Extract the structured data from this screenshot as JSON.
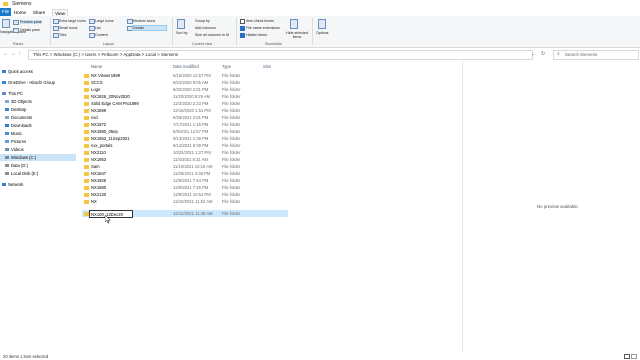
{
  "window": {
    "title": "Siemens"
  },
  "ribbon_tabs": [
    "File",
    "Home",
    "Share",
    "View"
  ],
  "ribbon": {
    "panes": {
      "navigation_pane": "Navigation pane",
      "preview_pane": "Preview pane",
      "details_pane": "Details pane",
      "group_label": "Panes"
    },
    "layout": {
      "items": [
        "Extra large icons",
        "Large icons",
        "Medium icons",
        "Small icons",
        "List",
        "Details",
        "Tiles",
        "Content"
      ],
      "selected": "Details",
      "group_label": "Layout"
    },
    "current_view": {
      "sort_by": "Sort by",
      "group_by": "Group by",
      "add_columns": "Add columns",
      "size_all_columns": "Size all columns to fit",
      "group_label": "Current view"
    },
    "show_hide": {
      "item_check_boxes": "Item check boxes",
      "file_name_extensions": "File name extensions",
      "hidden_items": "Hidden items",
      "hide_selected": "Hide selected items",
      "group_label": "Show/hide"
    },
    "options": "Options"
  },
  "address": {
    "breadcrumbs": [
      "This PC",
      "Windows (C:)",
      "Users",
      "Fetkoom",
      "AppData",
      "Local",
      "Siemens"
    ],
    "search_placeholder": "Search Siemens"
  },
  "nav_pane": {
    "items": [
      "Quick access",
      "OneDrive - Hitachi Group",
      "This PC",
      "3D Objects",
      "Desktop",
      "Documents",
      "Downloads",
      "Music",
      "Pictures",
      "Videos",
      "Windows (C:)",
      "Data (D:)",
      "Local Disk (E:)",
      "Network"
    ],
    "selected": "Windows (C:)"
  },
  "columns": {
    "name": "Name",
    "date_modified": "Date modified",
    "type": "Type",
    "size": "Size"
  },
  "files": [
    {
      "name": "NX Viewer1899",
      "date": "6/15/2020 12:57 PM",
      "type": "File folder"
    },
    {
      "name": "SCCS",
      "date": "6/22/2020 8:05 AM",
      "type": "File folder"
    },
    {
      "name": "Logs",
      "date": "6/22/2020 2:01 PM",
      "type": "File folder"
    },
    {
      "name": "NX1926_20Nov2020",
      "date": "11/20/2020 8:29 AM",
      "type": "File folder"
    },
    {
      "name": "Solid Edge CAM Pro1899",
      "date": "12/3/2020 2:33 PM",
      "type": "File folder"
    },
    {
      "name": "NX1899",
      "date": "12/18/2020 1:51 PM",
      "type": "File folder"
    },
    {
      "name": "nxd",
      "date": "6/28/2021 2:01 PM",
      "type": "File folder"
    },
    {
      "name": "NX1872",
      "date": "7/17/2021 1:15 PM",
      "type": "File folder"
    },
    {
      "name": "NX1980_05ep",
      "date": "8/9/2021 12:57 PM",
      "type": "File folder"
    },
    {
      "name": "NX1953_11Sep2021",
      "date": "9/13/2021 1:38 PM",
      "type": "File folder"
    },
    {
      "name": "nxx_portals",
      "date": "9/14/2021 8:38 PM",
      "type": "File folder"
    },
    {
      "name": "NX2110",
      "date": "10/22/2021 1:27 PM",
      "type": "File folder"
    },
    {
      "name": "NX1953",
      "date": "11/4/2021 8:31 AM",
      "type": "File folder"
    },
    {
      "name": "Sam",
      "date": "11/10/2021 10:16 AM",
      "type": "File folder"
    },
    {
      "name": "NX1847",
      "date": "11/25/2021 3:38 PM",
      "type": "File folder"
    },
    {
      "name": "NX1926",
      "date": "12/9/2021 7:44 PM",
      "type": "File folder"
    },
    {
      "name": "NX1880",
      "date": "12/9/2021 7:45 PM",
      "type": "File folder"
    },
    {
      "name": "NX2120",
      "date": "12/9/2021 10:51 PM",
      "type": "File folder"
    },
    {
      "name": "NX",
      "date": "12/10/2021 11:52 AM",
      "type": "File folder"
    }
  ],
  "renaming_row": {
    "value": "NX100_12Dec20",
    "date": "12/12/2021 11:38 AM",
    "type": "File folder"
  },
  "preview": {
    "message": "No preview available."
  },
  "status": {
    "text": "20 items   1 item selected"
  }
}
